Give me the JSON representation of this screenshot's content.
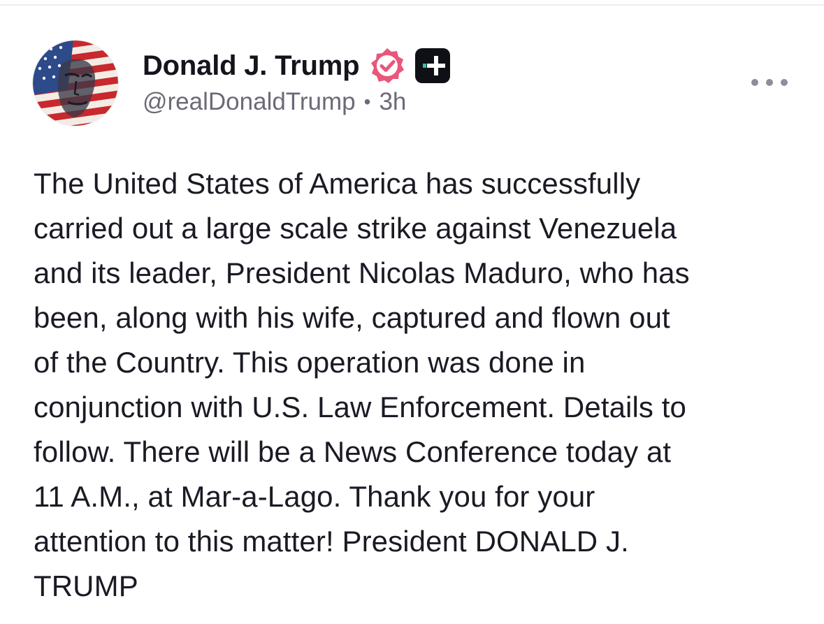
{
  "post": {
    "author": {
      "display_name": "Donald J. Trump",
      "handle": "@realDonaldTrump",
      "time_ago": "3h",
      "separator": "•"
    },
    "icons": {
      "verified": "verified-badge-icon",
      "plus": "plus-badge-icon",
      "more": "more-options-icon"
    },
    "colors": {
      "verified_badge": "#e9577a",
      "plus_badge": "#0f0f16",
      "plus_accent": "#2ec4a6",
      "handle_text": "#6b6a76",
      "body_text": "#1b1a24"
    },
    "body_lines": [
      "The United States of America has successfully",
      "carried out a large scale strike against Venezuela",
      "and its leader, President Nicolas Maduro, who has",
      "been, along with his wife, captured and flown out",
      "of the Country. This operation was done in",
      "conjunction with U.S. Law Enforcement. Details to",
      "follow. There will be a News Conference today at",
      "11 A.M., at Mar-a-Lago. Thank you for your",
      "attention to this matter! President DONALD J.",
      "TRUMP"
    ]
  }
}
